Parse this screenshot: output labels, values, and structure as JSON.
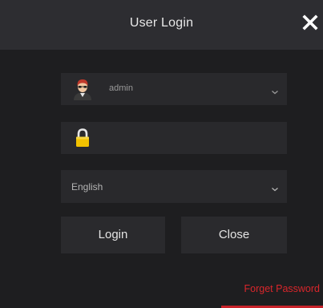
{
  "dialog": {
    "title": "User Login",
    "close_icon": "close-icon"
  },
  "username": {
    "icon": "user-avatar-icon",
    "value": "admin",
    "dropdown_icon": "chevron-down-icon"
  },
  "password": {
    "icon": "lock-icon",
    "value": ""
  },
  "language": {
    "value": "English",
    "dropdown_icon": "chevron-down-icon"
  },
  "buttons": {
    "login_label": "Login",
    "close_label": "Close"
  },
  "forgot_password": {
    "label": "Forget Password",
    "color": "#d9262b"
  },
  "colors": {
    "background": "#1e1e20",
    "titlebar": "#2d2d31",
    "field": "#29292c",
    "accent": "#c8232a"
  }
}
